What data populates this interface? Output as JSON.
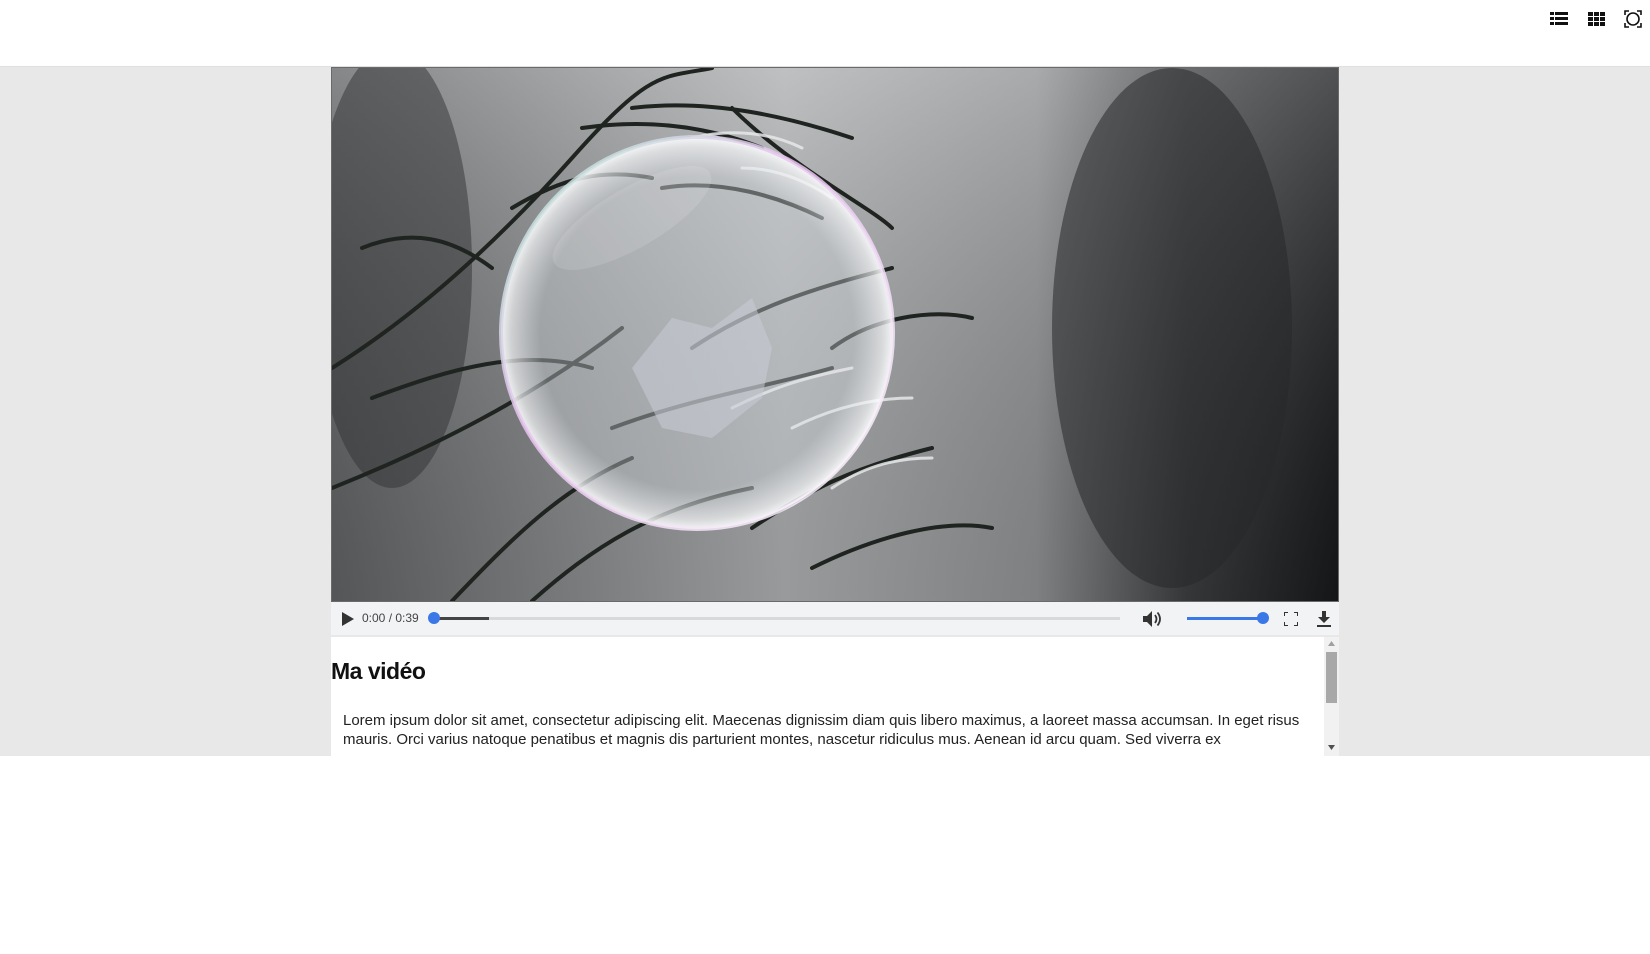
{
  "toolbar": {
    "icons": [
      "list-view-icon",
      "grid-view-icon",
      "fullscreen-toggle-icon"
    ]
  },
  "player": {
    "time_display": "0:00 / 0:39",
    "progress_fraction": 0.0,
    "buffered_fraction": 0.08,
    "volume_fraction": 1.0,
    "accent_color": "#3b78e7",
    "icons": [
      "play-icon",
      "volume-icon",
      "fullscreen-icon",
      "download-icon"
    ]
  },
  "article": {
    "title": "Ma vidéo",
    "body": "Lorem ipsum dolor sit amet, consectetur adipiscing elit. Maecenas dignissim diam quis libero maximus, a laoreet massa accumsan. In eget risus mauris. Orci varius natoque penatibus et magnis dis parturient montes, nascetur ridiculus mus. Aenean id arcu quam. Sed viverra ex"
  }
}
